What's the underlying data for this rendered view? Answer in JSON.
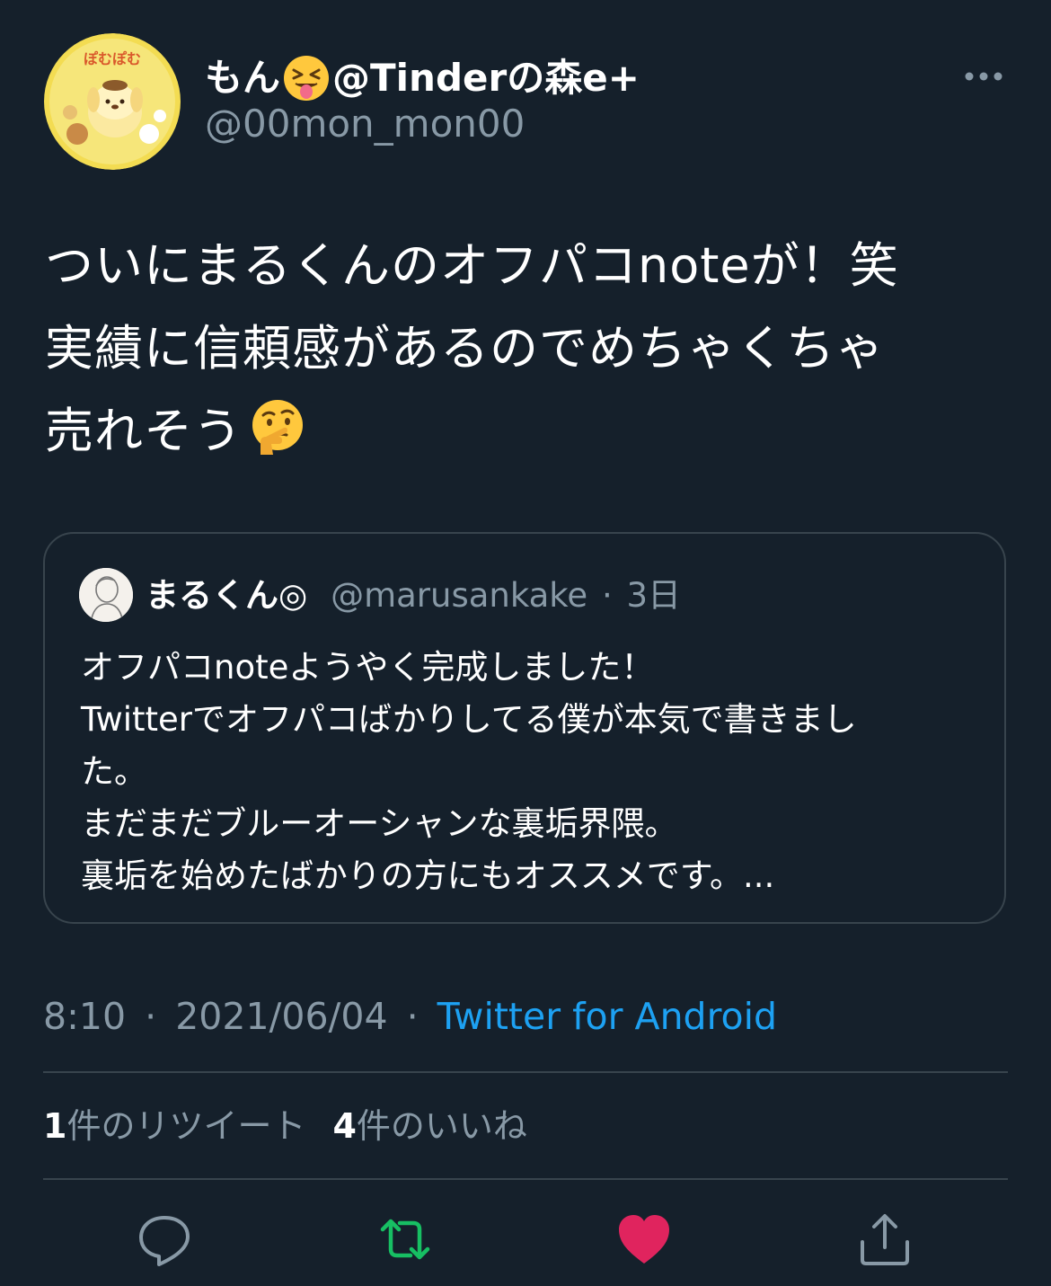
{
  "author": {
    "display_name_pre": "もん",
    "display_name_post": "@Tinderの森e+",
    "handle": "@00mon_mon00",
    "avatar_icon": "pompompurin-avatar",
    "name_emoji": "squinting-face-with-tongue-emoji"
  },
  "tweet": {
    "lines": [
      "ついにまるくんのオフパコnoteが！笑",
      "実績に信頼感があるのでめちゃくちゃ",
      "売れそう"
    ],
    "trailing_emoji": "thinking-face-emoji"
  },
  "quote": {
    "name": "まるくん◎",
    "handle": "@marusankake",
    "separator": "·",
    "time": "3日",
    "lines": [
      "オフパコnoteようやく完成しました！",
      "Twitterでオフパコばかりしてる僕が本気で書きまし",
      "た。",
      "まだまだブルーオーシャンな裏垢界隈。",
      "裏垢を始めたばかりの方にもオススメです。..."
    ]
  },
  "meta": {
    "time": "8:10",
    "separator": "·",
    "date": "2021/06/04",
    "source": "Twitter for Android"
  },
  "stats": {
    "retweets": "1",
    "retweets_label": "件のリツイート",
    "likes": "4",
    "likes_label": "件のいいね"
  },
  "colors": {
    "background": "#15202b",
    "secondary_text": "#8899a6",
    "link": "#1da1f2",
    "retweet": "#17bf63",
    "like": "#e0245e",
    "border": "#38444d"
  },
  "actions": [
    "reply-icon",
    "retweet-icon",
    "like-icon",
    "share-icon"
  ]
}
